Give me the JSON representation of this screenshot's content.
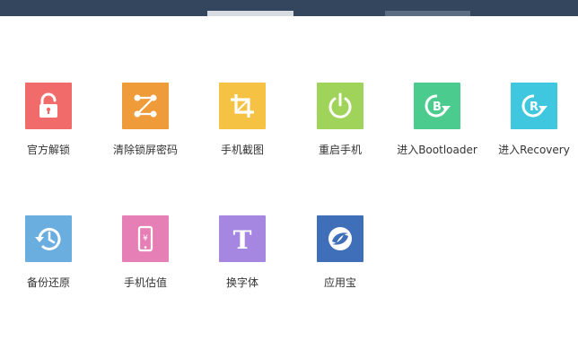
{
  "window": {
    "tabs": [
      {
        "state": "active"
      },
      {
        "state": "inactive"
      }
    ]
  },
  "tools": [
    {
      "label": "官方解锁",
      "icon": "unlock-icon",
      "color": "#f26b6b"
    },
    {
      "label": "清除锁屏密码",
      "icon": "pattern-lock-icon",
      "color": "#ef9b3a"
    },
    {
      "label": "手机截图",
      "icon": "crop-icon",
      "color": "#f5c243"
    },
    {
      "label": "重启手机",
      "icon": "power-icon",
      "color": "#9fd35a"
    },
    {
      "label": "进入Bootloader",
      "icon": "bootloader-icon",
      "color": "#4ccb8e"
    },
    {
      "label": "进入Recovery",
      "icon": "recovery-icon",
      "color": "#3fc7df"
    },
    {
      "label": "备份还原",
      "icon": "backup-restore-icon",
      "color": "#6aaee0"
    },
    {
      "label": "手机估值",
      "icon": "phone-value-icon",
      "color": "#e77fb7"
    },
    {
      "label": "换字体",
      "icon": "font-icon",
      "color": "#a586e0"
    },
    {
      "label": "应用宝",
      "icon": "app-store-icon",
      "color": "#3f6fb8"
    }
  ]
}
